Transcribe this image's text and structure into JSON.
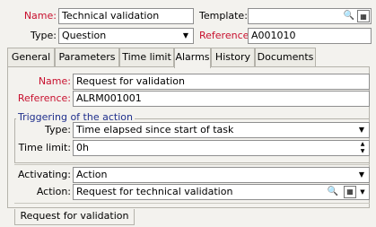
{
  "header": {
    "name_label": "Name:",
    "name_value": "Technical validation",
    "template_label": "Template:",
    "template_value": "",
    "type_label": "Type:",
    "type_value": "Question",
    "reference_label": "Reference:",
    "reference_value": "A001010"
  },
  "tabs": [
    {
      "label": "General"
    },
    {
      "label": "Parameters"
    },
    {
      "label": "Time limit"
    },
    {
      "label": "Alarms"
    },
    {
      "label": "History"
    },
    {
      "label": "Documents"
    }
  ],
  "alarm": {
    "name_label": "Name:",
    "name_value": "Request for validation",
    "reference_label": "Reference:",
    "reference_value": "ALRM001001",
    "group_title": "Triggering of the action",
    "type_label": "Type:",
    "type_value": "Time elapsed since start of task",
    "time_limit_label": "Time limit:",
    "time_limit_value": "0h",
    "activating_label": "Activating:",
    "activating_value": "Action",
    "action_label": "Action:",
    "action_value": "Request for technical validation"
  },
  "bottom_tab": {
    "label": "Request for validation"
  },
  "colors": {
    "required_label": "#c8102e",
    "group_title": "#1f2f8c",
    "background": "#f3f2ee"
  }
}
